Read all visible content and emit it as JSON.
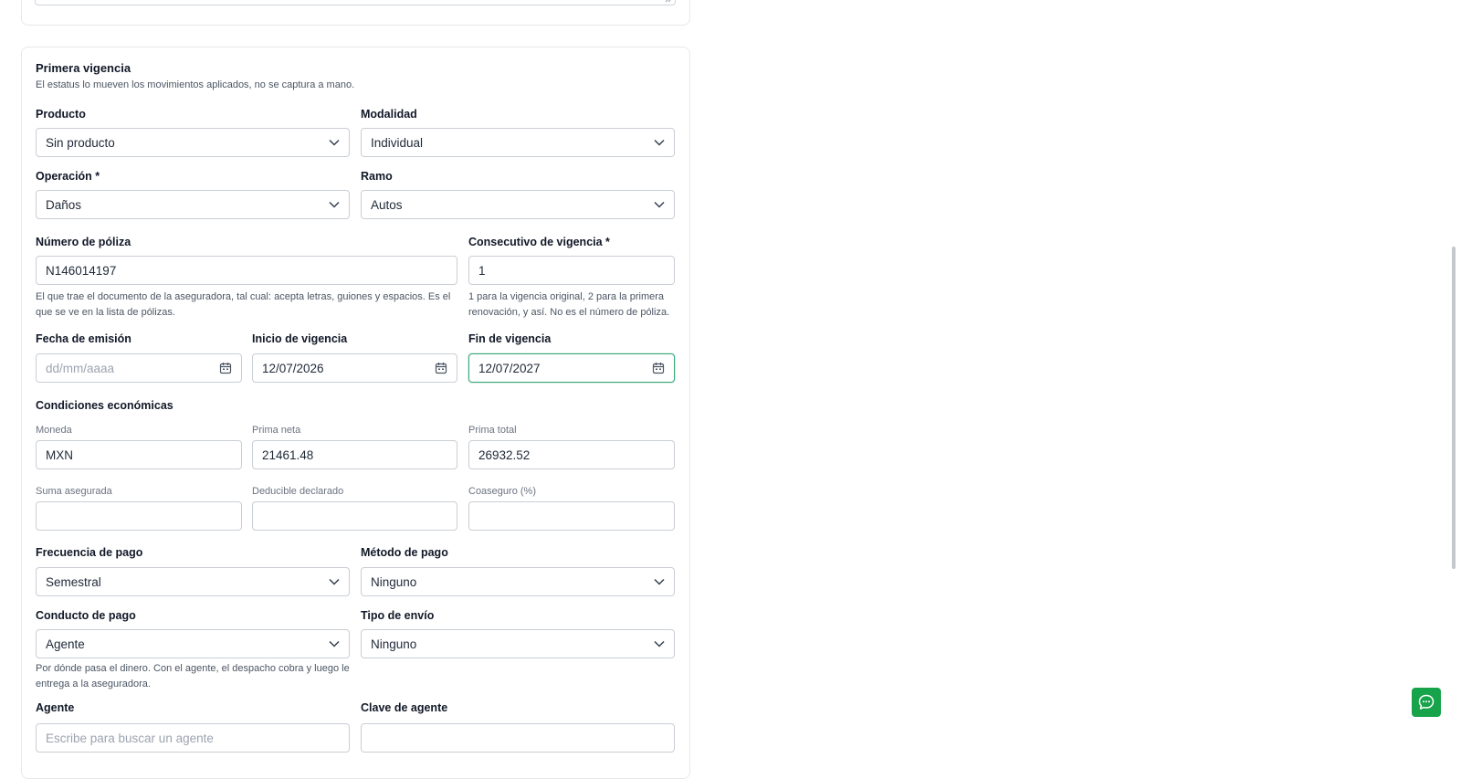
{
  "section": {
    "title": "Primera vigencia",
    "subtitle": "El estatus lo mueven los movimientos aplicados, no se captura a mano."
  },
  "fields": {
    "producto": {
      "label": "Producto",
      "value": "Sin producto"
    },
    "modalidad": {
      "label": "Modalidad",
      "value": "Individual"
    },
    "operacion": {
      "label": "Operación *",
      "value": "Daños"
    },
    "ramo": {
      "label": "Ramo",
      "value": "Autos"
    },
    "numero_poliza": {
      "label": "Número de póliza",
      "value": "N146014197",
      "help": "El que trae el documento de la aseguradora, tal cual: acepta letras, guiones y espacios. Es el que se ve en la lista de pólizas."
    },
    "consecutivo": {
      "label": "Consecutivo de vigencia *",
      "value": "1",
      "help": "1 para la vigencia original, 2 para la primera renovación, y así. No es el número de póliza."
    },
    "fecha_emision": {
      "label": "Fecha de emisión",
      "placeholder": "dd/mm/aaaa"
    },
    "inicio_vigencia": {
      "label": "Inicio de vigencia",
      "value": "12/07/2026"
    },
    "fin_vigencia": {
      "label": "Fin de vigencia",
      "value": "12/07/2027"
    },
    "moneda": {
      "label": "Moneda",
      "value": "MXN"
    },
    "prima_neta": {
      "label": "Prima neta",
      "value": "21461.48"
    },
    "prima_total": {
      "label": "Prima total",
      "value": "26932.52"
    },
    "suma_asegurada": {
      "label": "Suma asegurada",
      "value": ""
    },
    "deducible": {
      "label": "Deducible declarado",
      "value": ""
    },
    "coaseguro": {
      "label": "Coaseguro (%)",
      "value": ""
    },
    "frecuencia_pago": {
      "label": "Frecuencia de pago",
      "value": "Semestral"
    },
    "metodo_pago": {
      "label": "Método de pago",
      "value": "Ninguno"
    },
    "conducto_pago": {
      "label": "Conducto de pago",
      "value": "Agente",
      "help": "Por dónde pasa el dinero. Con el agente, el despacho cobra y luego le entrega a la aseguradora."
    },
    "tipo_envio": {
      "label": "Tipo de envío",
      "value": "Ninguno"
    },
    "agente": {
      "label": "Agente",
      "placeholder": "Escribe para buscar un agente"
    },
    "clave_agente": {
      "label": "Clave de agente",
      "value": ""
    }
  },
  "economic": {
    "title": "Condiciones económicas"
  },
  "icons": {
    "chevron": "chevron-down-icon",
    "calendar": "calendar-icon",
    "chat": "chat-icon"
  },
  "colors": {
    "focus_border": "#3aa57a",
    "chat_button": "#16a34a"
  }
}
